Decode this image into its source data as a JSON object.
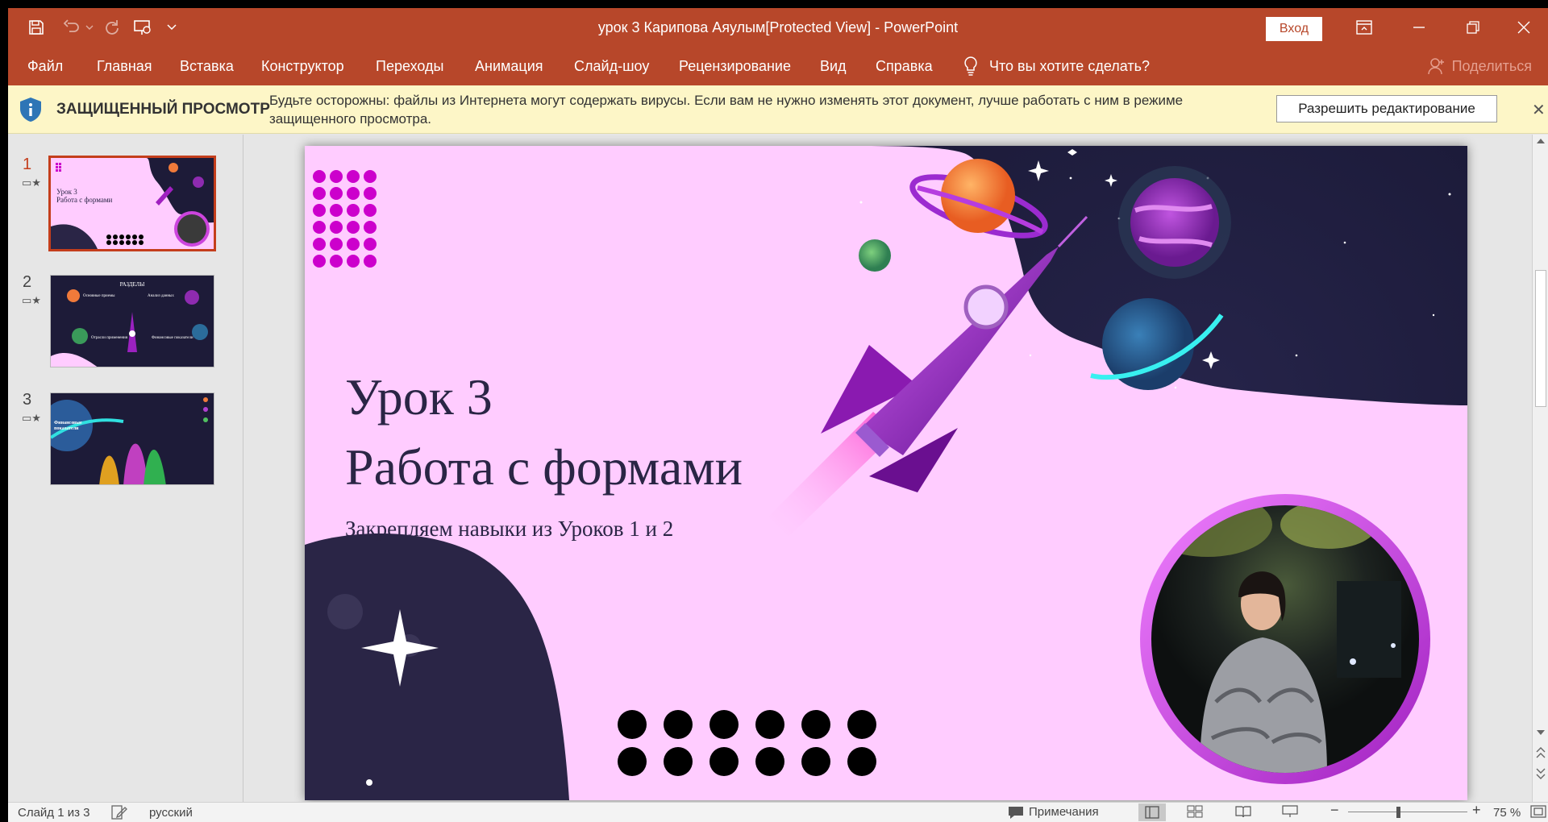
{
  "app": {
    "window_title": "урок 3 Карипова Аяулым[Protected View]  -  PowerPoint",
    "sign_in_label": "Вход"
  },
  "menu": {
    "items": [
      "Файл",
      "Главная",
      "Вставка",
      "Конструктор",
      "Переходы",
      "Анимация",
      "Слайд-шоу",
      "Рецензирование",
      "Вид",
      "Справка"
    ],
    "tell_me": "Что вы хотите сделать?",
    "share": "Поделиться"
  },
  "protected_view": {
    "title": "ЗАЩИЩЕННЫЙ ПРОСМОТР",
    "message": "Будьте осторожны: файлы из Интернета могут содержать вирусы. Если вам не нужно изменять этот документ, лучше работать с ним в режиме защищенного просмотра.",
    "enable_button": "Разрешить редактирование"
  },
  "thumbnails": [
    {
      "number": "1",
      "active": true,
      "title": "Урок 3",
      "subtitle": "Работа с формами"
    },
    {
      "number": "2",
      "active": false,
      "title": "РАЗДЕЛЫ",
      "labels": [
        "Основные приемы",
        "Анализ данных",
        "Отрасли применения",
        "Финансовые показатели"
      ]
    },
    {
      "number": "3",
      "active": false,
      "title": "Финансовые показатели"
    }
  ],
  "slide": {
    "title_line1": "Урок 3",
    "title_line2": "Работа с формами",
    "subtitle": "Закрепляем навыки из Уроков 1 и 2"
  },
  "status": {
    "slide_counter": "Слайд 1 из 3",
    "language": "русский",
    "notes": "Примечания",
    "zoom": "75 %"
  },
  "colors": {
    "title_bar": "#b7472a",
    "protected_bar": "#fdf6c7",
    "slide_background": "#ffccff",
    "space_background": "#1d1b38",
    "accent_magenta": "#cc00cc"
  }
}
